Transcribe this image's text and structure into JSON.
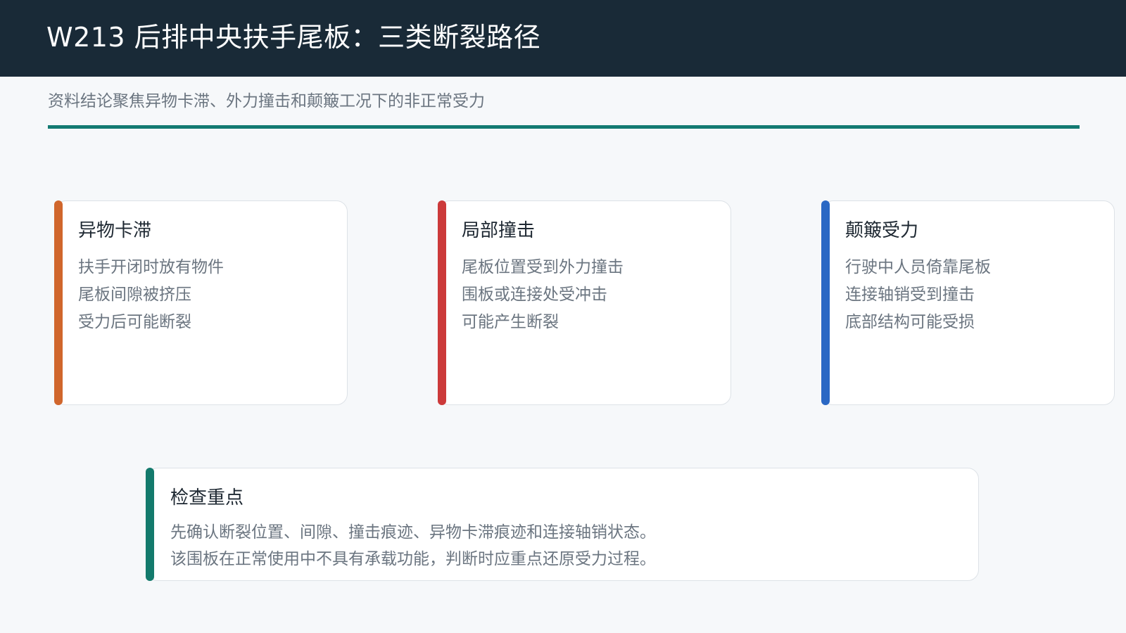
{
  "header": {
    "title": "W213 后排中央扶手尾板：三类断裂路径"
  },
  "subtitle": "资料结论聚焦异物卡滞、外力撞击和颠簸工况下的非正常受力",
  "colors": {
    "header_bg": "#192a37",
    "divider": "#137a72",
    "accent_orange": "#d0662c",
    "accent_red": "#cc3a3a",
    "accent_blue": "#2a68c4",
    "accent_teal": "#137a6c"
  },
  "cards": [
    {
      "title": "异物卡滞",
      "lines": [
        "扶手开闭时放有物件",
        "尾板间隙被挤压",
        "受力后可能断裂"
      ]
    },
    {
      "title": "局部撞击",
      "lines": [
        "尾板位置受到外力撞击",
        "围板或连接处受冲击",
        "可能产生断裂"
      ]
    },
    {
      "title": "颠簸受力",
      "lines": [
        "行驶中人员倚靠尾板",
        "连接轴销受到撞击",
        "底部结构可能受损"
      ]
    }
  ],
  "summary": {
    "title": "检查重点",
    "lines": [
      "先确认断裂位置、间隙、撞击痕迹、异物卡滞痕迹和连接轴销状态。",
      "该围板在正常使用中不具有承载功能，判断时应重点还原受力过程。"
    ]
  }
}
